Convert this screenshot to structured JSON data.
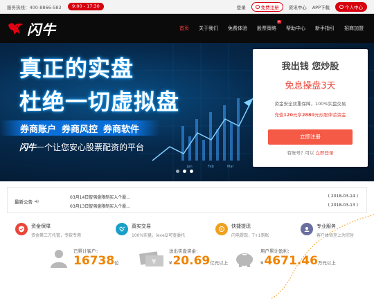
{
  "topbar": {
    "hotline_label": "服务热线：",
    "hotline_number": "400-8866-583",
    "hours": "9:00 - 17:30",
    "login": "登录",
    "register": "免费注册",
    "news": "资讯中心",
    "app": "APP下载",
    "personal": "个人中心"
  },
  "nav": {
    "logo_text": "闪牛",
    "items": [
      "首页",
      "关于我们",
      "免费体验",
      "股票策略",
      "帮助中心",
      "新手指引",
      "招商加盟"
    ],
    "hot_badge": "热"
  },
  "banner": {
    "headline1": "真正的实盘",
    "headline2": "杜绝一切虚拟盘",
    "tags": [
      "券商账户",
      "券商风控",
      "券商软件"
    ],
    "slogan_brand": "闪牛",
    "slogan_rest": "一个让您安心股票配资的平台",
    "slides": 3,
    "active_slide": 1
  },
  "card": {
    "title": "我出钱 您炒股",
    "subtitle": "免息操盘3天",
    "line1": "资金安全双重保障，100%实盘交易",
    "line2_pre": "充值",
    "line2_amt1": "120",
    "line2_mid": "元享",
    "line2_amt2": "2880",
    "line2_post": "元炒股体验资金",
    "cta": "立即注册",
    "have_account": "有账号？可以",
    "login_now": "立即登录"
  },
  "notice": {
    "label": "最新公告",
    "items": [
      {
        "title": "03月14日智强盘限制买入个股...",
        "date": "( 2018-03-14 )"
      },
      {
        "title": "03月13日智强盘限制买入个股...",
        "date": "( 2018-03-13 )"
      }
    ]
  },
  "features": [
    {
      "title": "资金保障",
      "desc": "资金第三方托管，专款专用",
      "color": "#e8463a",
      "icon": "shield-icon"
    },
    {
      "title": "真实交易",
      "desc": "100%实盘，level2可查委托",
      "color": "#1aa0c8",
      "icon": "handshake-icon"
    },
    {
      "title": "快捷提现",
      "desc": "闪电提现，T+1到账",
      "color": "#f0a020",
      "icon": "money-icon"
    },
    {
      "title": "专业服务",
      "desc": "客户体验至上为宗旨",
      "color": "#6a6fa0",
      "icon": "support-icon"
    }
  ],
  "stats": [
    {
      "label": "已累计客户：",
      "value": "16738",
      "prefix": "",
      "unit": "位"
    },
    {
      "label": "送出实盘资金：",
      "value": "20.69",
      "prefix": "¥",
      "unit": "亿元以上"
    },
    {
      "label": "用户累计盈利：",
      "value": "4671.46",
      "prefix": "¥",
      "unit": "万元以上"
    }
  ]
}
